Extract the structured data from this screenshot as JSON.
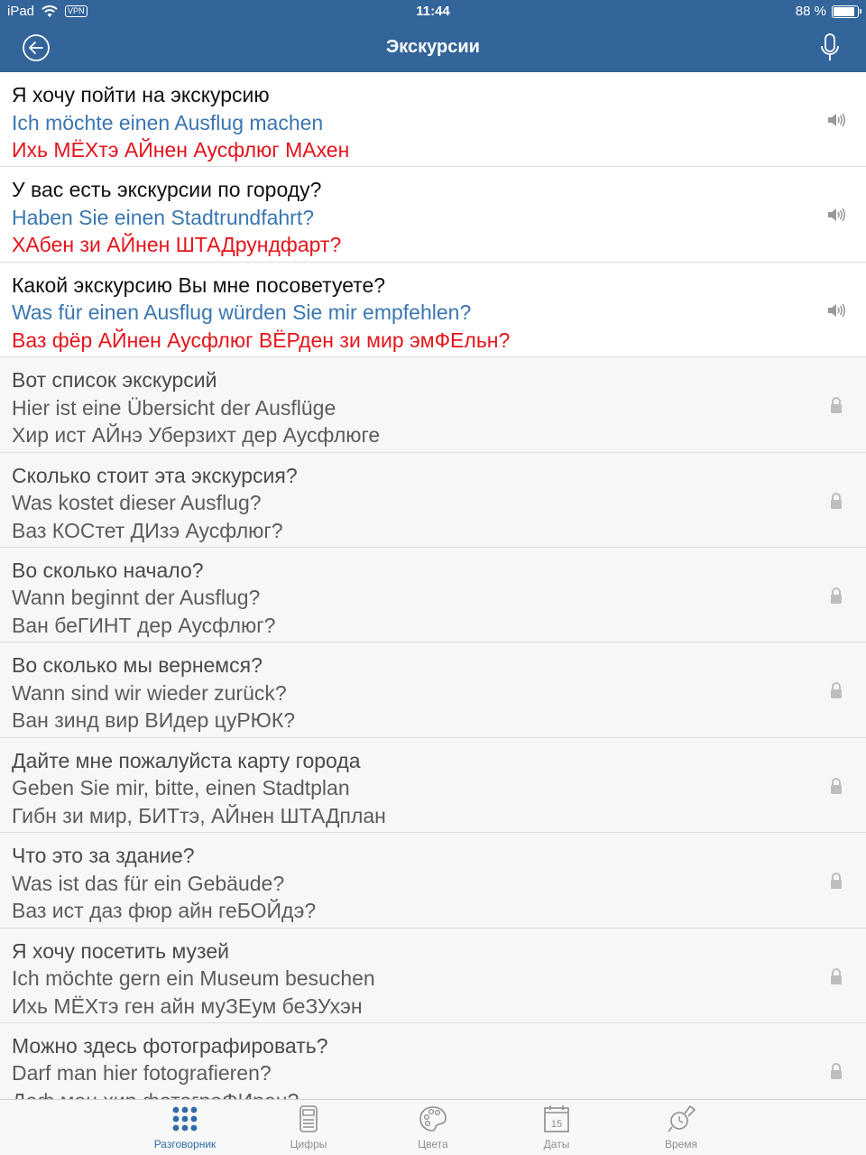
{
  "status_bar": {
    "device": "iPad",
    "vpn": "VPN",
    "time": "11:44",
    "battery_text": "88 %",
    "battery_level": 0.88
  },
  "nav": {
    "title": "Экскурсии",
    "back_icon": "back-arrow-icon",
    "mic_icon": "microphone-icon"
  },
  "phrases": [
    {
      "ru": "Я хочу пойти на экскурсию",
      "de": "Ich möchte einen Ausflug machen",
      "tr": "Ихь МЁХтэ АЙнен Аусфлюг МАхен",
      "locked": false
    },
    {
      "ru": "У вас есть экскурсии по городу?",
      "de": "Haben Sie einen Stadtrundfahrt?",
      "tr": "ХАбен зи АЙнен ШТАДрундфарт?",
      "locked": false
    },
    {
      "ru": "Какой экскурсию Вы  мне посоветуете?",
      "de": "Was für einen Ausflug würden Sie mir empfehlen?",
      "tr": "Ваз фёр АЙнен Аусфлюг ВЁРден зи мир эмФЕльн?",
      "locked": false
    },
    {
      "ru": "Вот список экскурсий",
      "de": "Hier ist eine Übersicht der Ausflüge",
      "tr": "Хир ист АЙнэ Уберзихт дер Аусфлюге",
      "locked": true
    },
    {
      "ru": "Сколько стоит эта экскурсия?",
      "de": "Was kostet dieser Ausflug?",
      "tr": "Ваз КОСтет ДИзэ Аусфлюг?",
      "locked": true
    },
    {
      "ru": "Во сколько начало?",
      "de": "Wann beginnt der Ausflug?",
      "tr": "Ван беГИНТ дер Аусфлюг?",
      "locked": true
    },
    {
      "ru": "Во сколько мы вернемся?",
      "de": "Wann sind wir wieder zurück?",
      "tr": "Ван зинд вир ВИдер цуРЮК?",
      "locked": true
    },
    {
      "ru": "Дайте мне пожалуйста карту города",
      "de": "Geben Sie mir, bitte, einen Stadtplan",
      "tr": "Гибн зи мир, БИТтэ, АЙнен ШТАДплан",
      "locked": true
    },
    {
      "ru": "Что это за здание?",
      "de": "Was ist das für ein Gebäude?",
      "tr": "Ваз ист даз фюр айн геБОЙдэ?",
      "locked": true
    },
    {
      "ru": "Я хочу посетить музей",
      "de": "Ich möchte gern ein Museum besuchen",
      "tr": "Ихь МЁХтэ ген айн муЗЕум беЗУхэн",
      "locked": true
    },
    {
      "ru": "Можно здесь фотографировать?",
      "de": "Darf man hier fotografieren?",
      "tr": "Даф ман хир фотограФИрен?",
      "locked": true
    }
  ],
  "tabs": [
    {
      "label": "Разговорник",
      "icon": "grid-dots-icon",
      "active": true
    },
    {
      "label": "Цифры",
      "icon": "calculator-icon",
      "active": false
    },
    {
      "label": "Цвета",
      "icon": "palette-icon",
      "active": false
    },
    {
      "label": "Даты",
      "icon": "calendar-icon",
      "day": "15",
      "active": false
    },
    {
      "label": "Время",
      "icon": "watch-icon",
      "active": false
    }
  ],
  "colors": {
    "header_bg": "#33659a",
    "german_text": "#3a76b0",
    "transcription_text": "#e5141b",
    "tab_active": "#2f6aa8",
    "tab_inactive": "#8e8e8e"
  }
}
